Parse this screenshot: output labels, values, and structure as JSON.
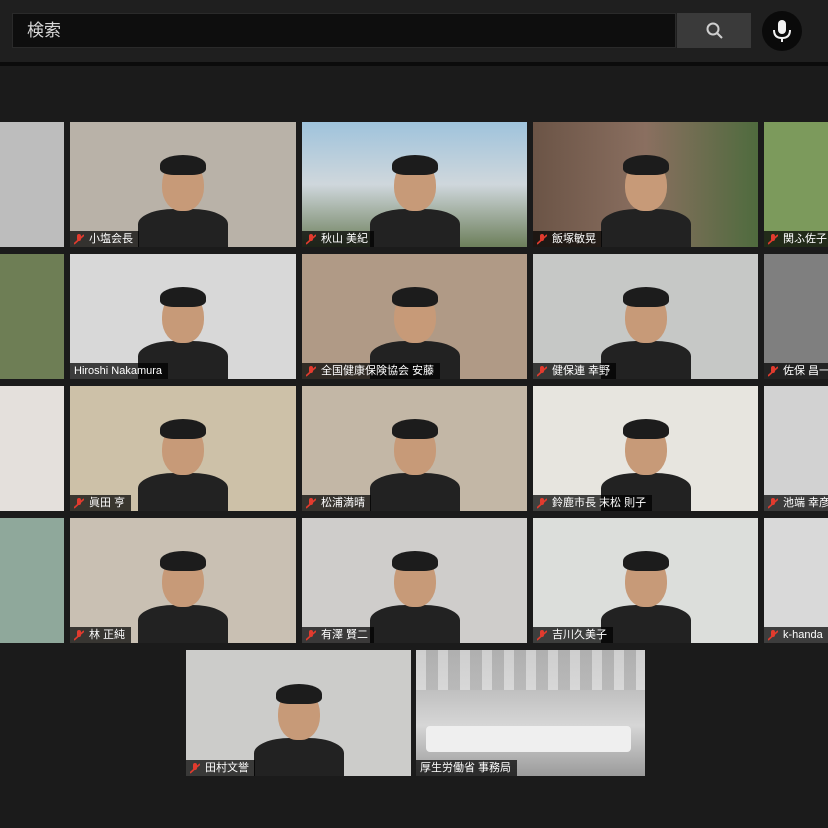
{
  "search": {
    "placeholder": "検索"
  },
  "icons": {
    "search": "search-icon",
    "mic": "microphone-icon",
    "muted": "mic-muted-icon"
  },
  "colors": {
    "active_border": "#c7e27a",
    "muted_icon": "#e23b2e"
  },
  "participants": [
    {
      "name": "",
      "muted": false
    },
    {
      "name": "小塩会長",
      "muted": true
    },
    {
      "name": "秋山 美紀",
      "muted": true
    },
    {
      "name": "飯塚敏晃",
      "muted": true
    },
    {
      "name": "関ふ佐子",
      "muted": true
    },
    {
      "name": "",
      "muted": false
    },
    {
      "name": "Hiroshi Nakamura",
      "muted": false
    },
    {
      "name": "全国健康保険協会 安藤",
      "muted": true
    },
    {
      "name": "健保連 幸野",
      "muted": true
    },
    {
      "name": "佐保 昌一",
      "muted": true
    },
    {
      "name": "",
      "muted": false
    },
    {
      "name": "眞田 亨",
      "muted": true
    },
    {
      "name": "松浦満晴",
      "muted": true
    },
    {
      "name": "鈴鹿市長 末松 則子",
      "muted": true
    },
    {
      "name": "池端 幸彦",
      "muted": true
    },
    {
      "name": "",
      "muted": false
    },
    {
      "name": "林 正純",
      "muted": true
    },
    {
      "name": "有澤 賢二",
      "muted": true
    },
    {
      "name": "吉川久美子",
      "muted": true
    },
    {
      "name": "k-handa",
      "muted": true
    },
    {
      "name": "田村文誉",
      "muted": true
    },
    {
      "name": "厚生労働省 事務局",
      "muted": false
    }
  ]
}
